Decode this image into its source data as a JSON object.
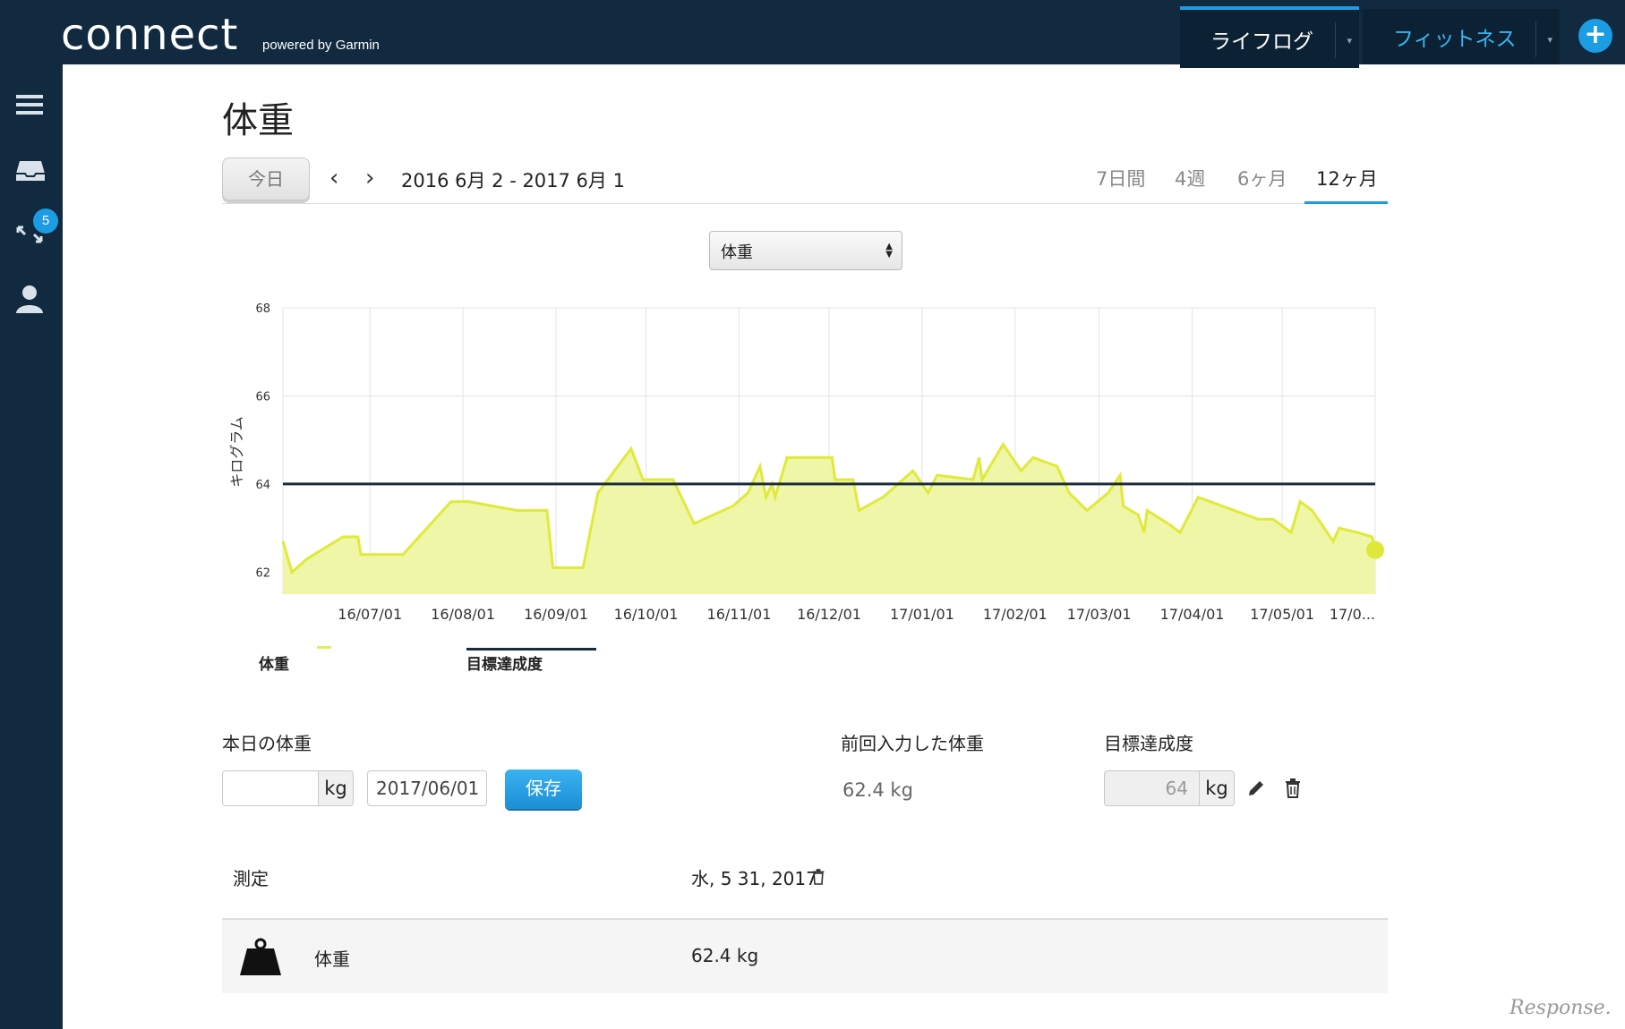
{
  "header": {
    "logo": "connect",
    "powered_by": "powered by Garmin",
    "tabs": [
      {
        "label": "ライフログ"
      },
      {
        "label": "フィットネス"
      }
    ],
    "add_label": "+"
  },
  "sidebar": {
    "badge_count": "5",
    "items": [
      "menu-icon",
      "inbox-icon",
      "connections-icon",
      "profile-icon"
    ]
  },
  "page": {
    "title": "体重",
    "today_button": "今日",
    "date_range": "2016 6月 2 - 2017 6月 1",
    "periods": [
      "7日間",
      "4週",
      "6ヶ月",
      "12ヶ月"
    ],
    "active_period": "12ヶ月",
    "metric_select": "体重"
  },
  "chart_data": {
    "type": "area",
    "ylabel": "キログラム",
    "ylim": [
      61.5,
      68
    ],
    "y_ticks": [
      "68",
      "66",
      "64",
      "62"
    ],
    "x_ticks": [
      "16/07/01",
      "16/08/01",
      "16/09/01",
      "16/10/01",
      "16/11/01",
      "16/12/01",
      "17/01/01",
      "17/02/01",
      "17/03/01",
      "17/04/01",
      "17/05/01",
      "17/0..."
    ],
    "x_range_days": [
      0,
      364
    ],
    "series": [
      {
        "name": "体重",
        "color": "#e4ef52",
        "points": [
          [
            0,
            62.7
          ],
          [
            3,
            62.0
          ],
          [
            8,
            62.3
          ],
          [
            20,
            62.8
          ],
          [
            25,
            62.8
          ],
          [
            26,
            62.4
          ],
          [
            40,
            62.4
          ],
          [
            56,
            63.6
          ],
          [
            62,
            63.6
          ],
          [
            78,
            63.4
          ],
          [
            88,
            63.4
          ],
          [
            90,
            62.1
          ],
          [
            100,
            62.1
          ],
          [
            105,
            63.8
          ],
          [
            116,
            64.8
          ],
          [
            120,
            64.1
          ],
          [
            130,
            64.1
          ],
          [
            137,
            63.1
          ],
          [
            150,
            63.5
          ],
          [
            155,
            63.8
          ],
          [
            159,
            64.4
          ],
          [
            161,
            63.7
          ],
          [
            163,
            64.0
          ],
          [
            164,
            63.7
          ],
          [
            168,
            64.6
          ],
          [
            183,
            64.6
          ],
          [
            184,
            64.1
          ],
          [
            190,
            64.1
          ],
          [
            192,
            63.4
          ],
          [
            200,
            63.7
          ],
          [
            210,
            64.3
          ],
          [
            215,
            63.8
          ],
          [
            218,
            64.2
          ],
          [
            230,
            64.1
          ],
          [
            232,
            64.6
          ],
          [
            233,
            64.1
          ],
          [
            240,
            64.9
          ],
          [
            246,
            64.3
          ],
          [
            250,
            64.6
          ],
          [
            258,
            64.4
          ],
          [
            262,
            63.8
          ],
          [
            268,
            63.4
          ],
          [
            275,
            63.8
          ],
          [
            279,
            64.2
          ],
          [
            280,
            63.5
          ],
          [
            285,
            63.3
          ],
          [
            287,
            62.9
          ],
          [
            288,
            63.4
          ],
          [
            295,
            63.1
          ],
          [
            299,
            62.9
          ],
          [
            305,
            63.7
          ],
          [
            325,
            63.2
          ],
          [
            330,
            63.2
          ],
          [
            336,
            62.9
          ],
          [
            339,
            63.6
          ],
          [
            343,
            63.4
          ],
          [
            350,
            62.7
          ],
          [
            352,
            63.0
          ],
          [
            358,
            62.9
          ],
          [
            363,
            62.8
          ],
          [
            364,
            62.5
          ]
        ]
      },
      {
        "name": "目標達成度",
        "color": "#1a2a3a",
        "values": [
          64,
          64
        ]
      }
    ],
    "legend": [
      "体重",
      "目標達成度"
    ],
    "legend_position": "bottom-left",
    "grid": true
  },
  "entry": {
    "today_label": "本日の体重",
    "weight_value": "",
    "unit": "kg",
    "date_value": "2017/06/01",
    "save_label": "保存",
    "last_label": "前回入力した体重",
    "last_value": "62.4 kg",
    "goal_label": "目標達成度",
    "goal_value": "64",
    "goal_unit": "kg"
  },
  "table": {
    "head_measure": "測定",
    "head_date": "水, 5 31, 2017",
    "row_label": "体重",
    "row_value": "62.4  kg"
  },
  "watermark": "Response."
}
